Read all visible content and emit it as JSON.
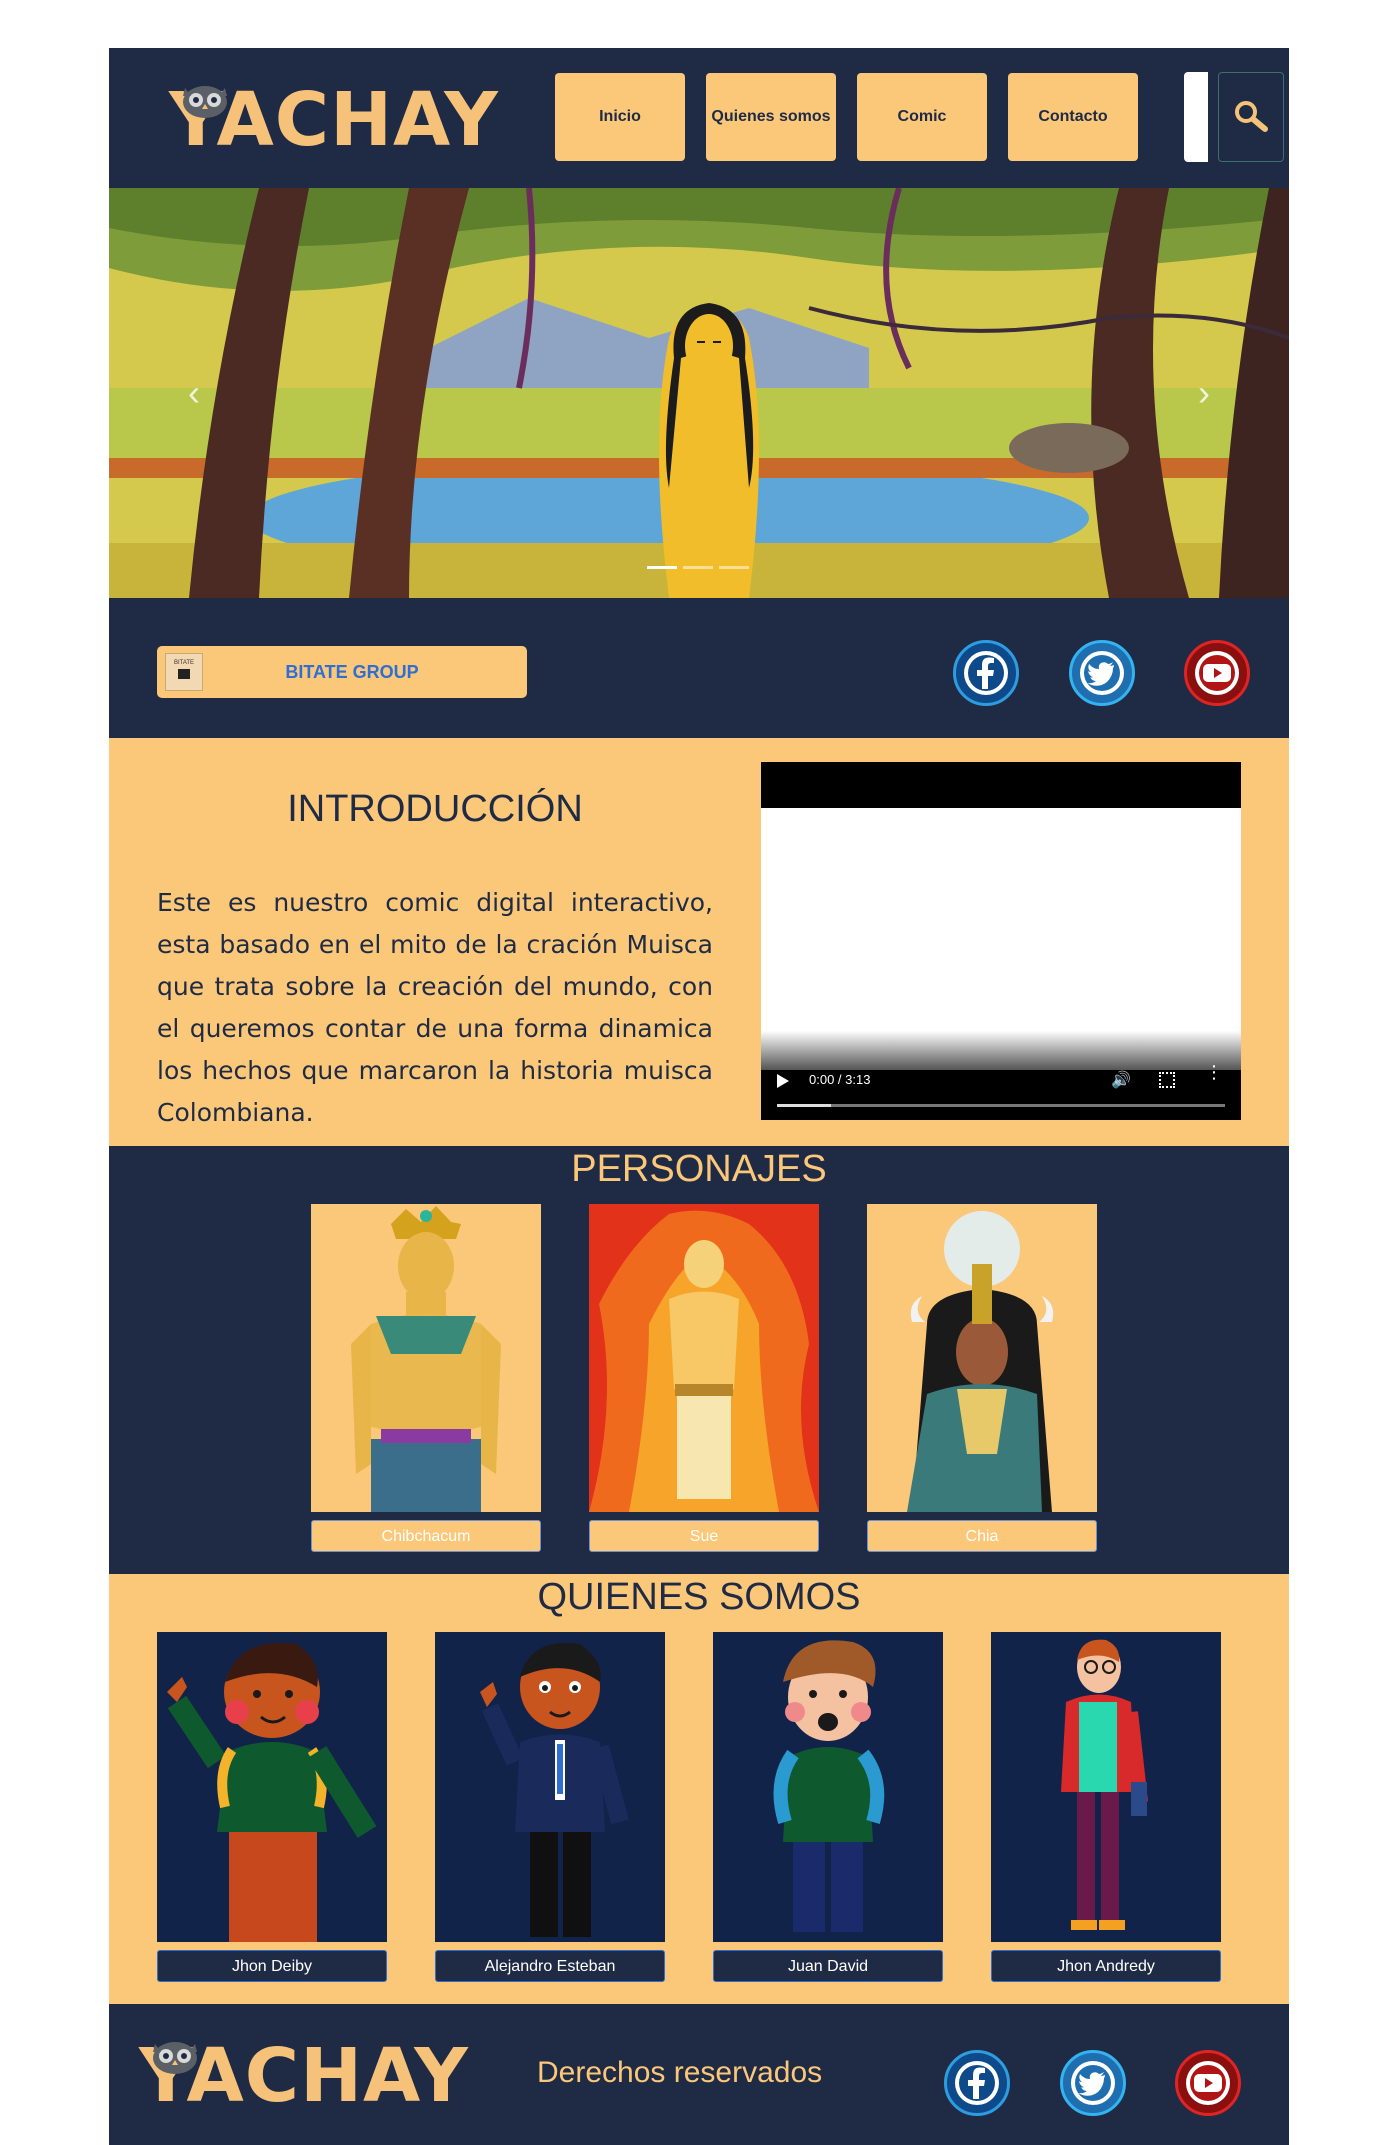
{
  "header": {
    "logo_text": "YACHAY",
    "nav": [
      "Inicio",
      "Quienes somos",
      "Comic",
      "Contacto"
    ],
    "search_placeholder": ""
  },
  "hero": {
    "prev_arrow": "‹",
    "next_arrow": "›",
    "slides": 3,
    "active_slide": 1
  },
  "social_bar": {
    "group_label": "BITATE GROUP",
    "group_thumb_text": "BITATE",
    "icons": [
      "facebook-icon",
      "twitter-icon",
      "youtube-icon"
    ]
  },
  "intro": {
    "title": "INTRODUCCIÓN",
    "text": "Este es nuestro comic digital interactivo, esta basado en el mito de la cración Muisca que trata sobre la creación del mundo, con el queremos contar de una forma dinamica los hechos que marcaron la historia muisca Colombiana.",
    "video": {
      "time": "0:00 / 3:13",
      "progress": 0.12
    }
  },
  "personajes": {
    "title": "PERSONAJES",
    "items": [
      "Chibchacum",
      "Sue",
      "Chia"
    ]
  },
  "quienes": {
    "title": "QUIENES SOMOS",
    "members": [
      "Jhon Deiby",
      "Alejandro Esteban",
      "Juan David",
      "Jhon Andredy"
    ]
  },
  "footer": {
    "logo_text": "YACHAY",
    "rights": "Derechos reservados"
  },
  "colors": {
    "navy": "#1f2b45",
    "gold": "#fbc779",
    "link_blue": "#2f6fd3"
  }
}
